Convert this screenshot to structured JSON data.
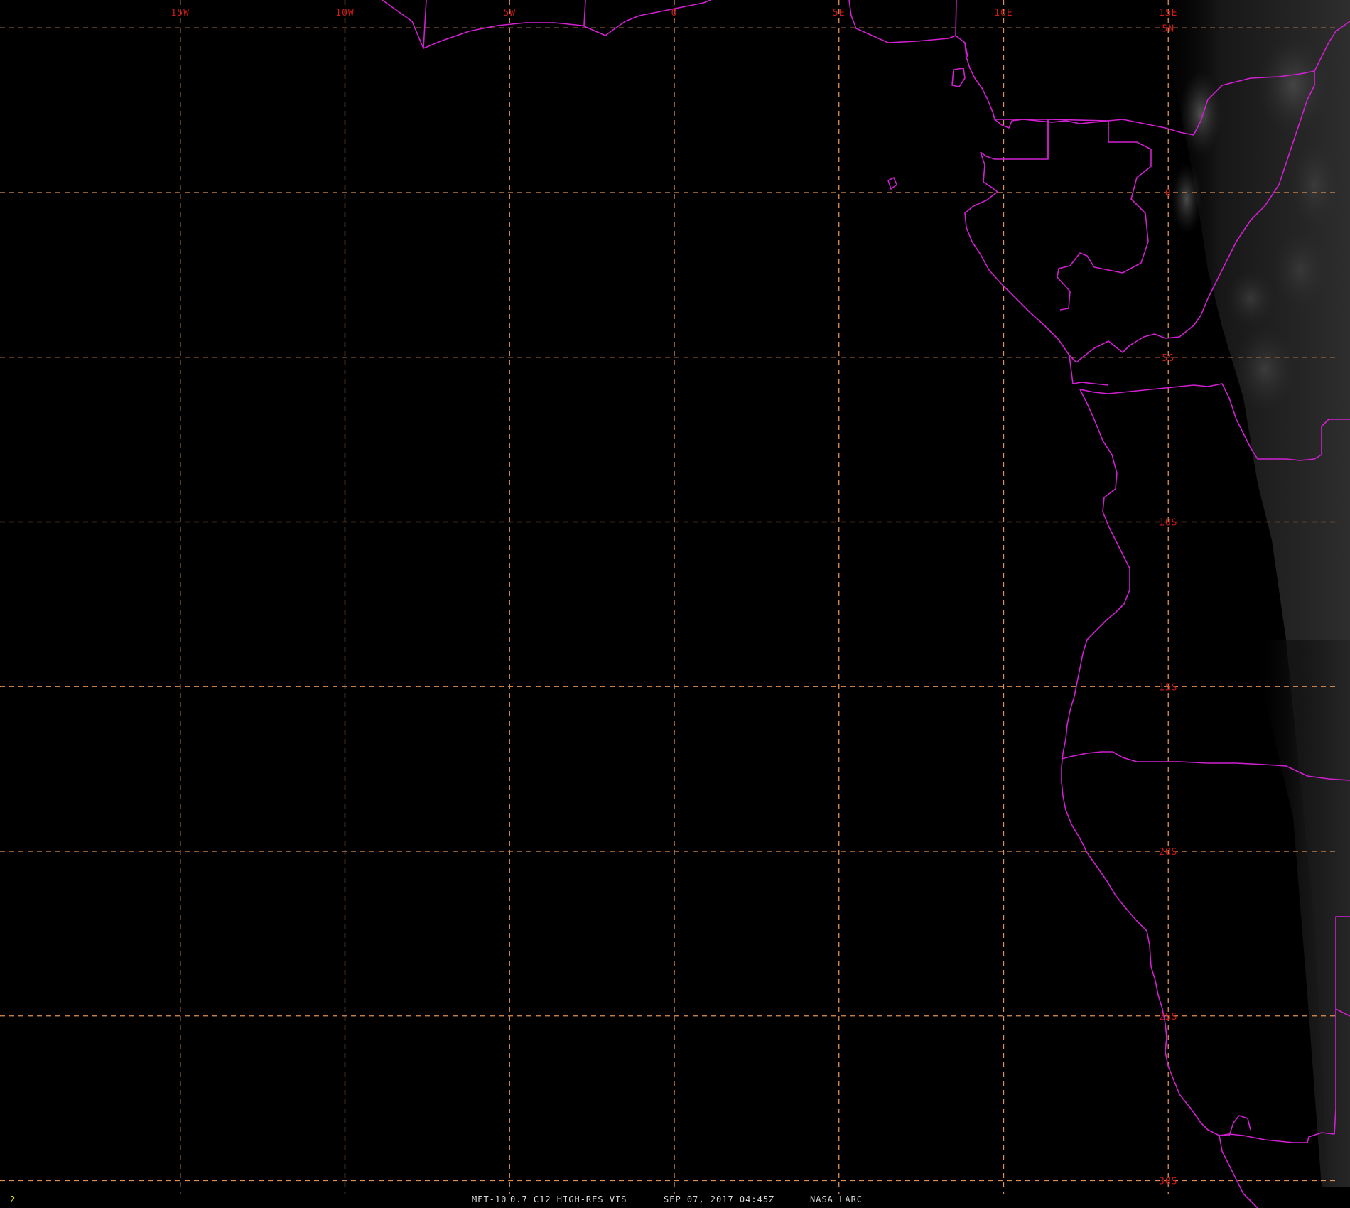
{
  "frame": {
    "number": "2",
    "number_color": "#e8e800"
  },
  "caption": {
    "satellite": "MET-10",
    "channel": "0.7 C12 HIGH-RES VIS",
    "datetime": "SEP 07, 2017 04:45Z",
    "source": "NASA LARC"
  },
  "grid": {
    "longitudes": [
      {
        "value": -15,
        "label": "15W"
      },
      {
        "value": -10,
        "label": "10W"
      },
      {
        "value": -5,
        "label": "5W"
      },
      {
        "value": 0,
        "label": "0"
      },
      {
        "value": 5,
        "label": "5E"
      },
      {
        "value": 10,
        "label": "10E"
      },
      {
        "value": 15,
        "label": "15E"
      }
    ],
    "latitudes": [
      {
        "value": 5,
        "label": "5N"
      },
      {
        "value": 0,
        "label": "0"
      },
      {
        "value": -5,
        "label": "5S"
      },
      {
        "value": -10,
        "label": "10S"
      },
      {
        "value": -15,
        "label": "15S"
      },
      {
        "value": -20,
        "label": "20S"
      },
      {
        "value": -25,
        "label": "25S"
      },
      {
        "value": -30,
        "label": "30S"
      }
    ],
    "line_color": "#e09050",
    "label_color": "#cc1a1a"
  },
  "map": {
    "background_color": "#000000",
    "coast_color": "#d020d0",
    "imagery": "visible satellite imagery, night side over Atlantic, faint cloud over central Africa"
  }
}
